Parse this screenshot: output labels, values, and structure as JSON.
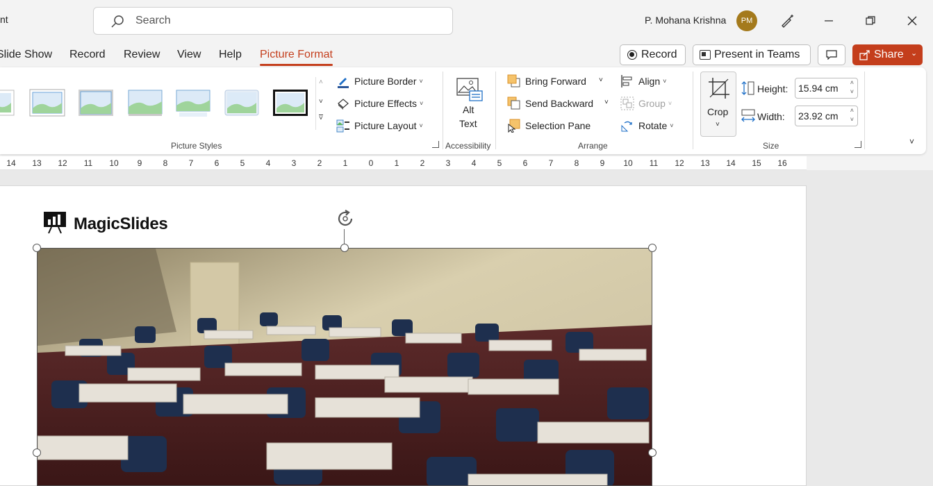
{
  "titlebar": {
    "app_title_fragment": "nt",
    "search_placeholder": "Search",
    "user_name": "P. Mohana Krishna",
    "user_initials": "PM"
  },
  "tabs": [
    {
      "label": "Slide Show"
    },
    {
      "label": "Record"
    },
    {
      "label": "Review"
    },
    {
      "label": "View"
    },
    {
      "label": "Help"
    },
    {
      "label": "Picture Format",
      "active": true
    }
  ],
  "actions": {
    "record_label": "Record",
    "present_label": "Present in Teams",
    "share_label": "Share"
  },
  "ribbon": {
    "picture_styles": {
      "label": "Picture Styles",
      "picture_border": "Picture Border",
      "picture_effects": "Picture Effects",
      "picture_layout": "Picture Layout"
    },
    "accessibility": {
      "label": "Accessibility",
      "alt_text_line1": "Alt",
      "alt_text_line2": "Text"
    },
    "arrange": {
      "label": "Arrange",
      "bring_forward": "Bring Forward",
      "send_backward": "Send Backward",
      "selection_pane": "Selection Pane",
      "align": "Align",
      "group": "Group",
      "rotate": "Rotate"
    },
    "size": {
      "label": "Size",
      "crop": "Crop",
      "height_label": "Height:",
      "height_value": "15.94 cm",
      "width_label": "Width:",
      "width_value": "23.92 cm"
    }
  },
  "ruler": [
    "14",
    "13",
    "12",
    "11",
    "10",
    "9",
    "8",
    "7",
    "6",
    "5",
    "4",
    "3",
    "2",
    "1",
    "0",
    "1",
    "2",
    "3",
    "4",
    "5",
    "6",
    "7",
    "8",
    "9",
    "10",
    "11",
    "12",
    "13",
    "14",
    "15",
    "16"
  ],
  "slide": {
    "logo_text": "MagicSlides"
  },
  "colors": {
    "accent": "#c43e1c",
    "avatar": "#a47a1c"
  }
}
